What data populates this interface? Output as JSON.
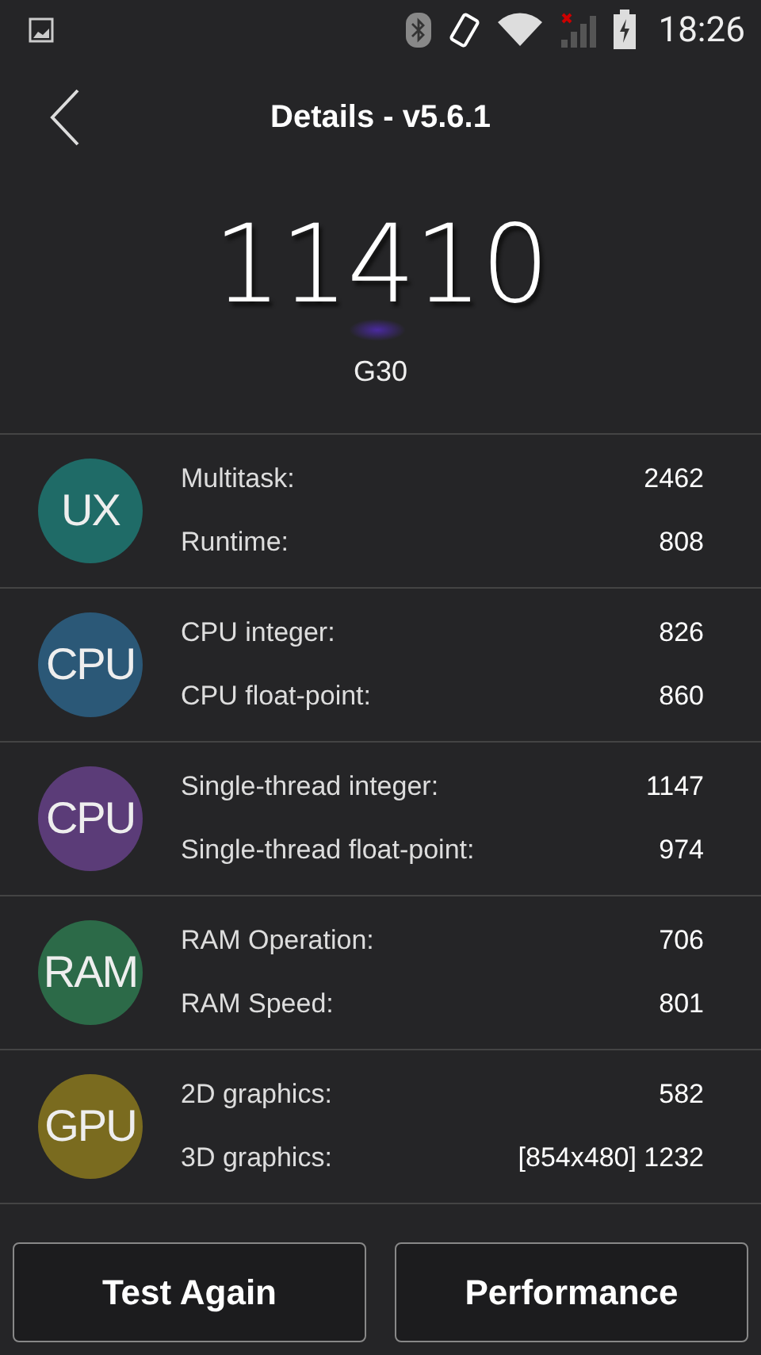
{
  "status_bar": {
    "time": "18:26"
  },
  "header": {
    "title": "Details - v5.6.1"
  },
  "score": "11410",
  "device": "G30",
  "sections": [
    {
      "badge": "UX",
      "color": "#1f6b67",
      "rows": [
        {
          "label": "Multitask:",
          "value": "2462"
        },
        {
          "label": "Runtime:",
          "value": "808"
        }
      ]
    },
    {
      "badge": "CPU",
      "color": "#2b5877",
      "rows": [
        {
          "label": "CPU integer:",
          "value": "826"
        },
        {
          "label": "CPU float-point:",
          "value": "860"
        }
      ]
    },
    {
      "badge": "CPU",
      "color": "#5b3c78",
      "rows": [
        {
          "label": "Single-thread integer:",
          "value": "1147"
        },
        {
          "label": "Single-thread float-point:",
          "value": "974"
        }
      ]
    },
    {
      "badge": "RAM",
      "color": "#2c6a48",
      "rows": [
        {
          "label": "RAM Operation:",
          "value": "706"
        },
        {
          "label": "RAM Speed:",
          "value": "801"
        }
      ]
    },
    {
      "badge": "GPU",
      "color": "#7a6b1f",
      "rows": [
        {
          "label": "2D graphics:",
          "value": "582"
        },
        {
          "label": "3D graphics:",
          "value": "[854x480] 1232"
        }
      ]
    }
  ],
  "buttons": [
    "Test Again",
    "Performance"
  ]
}
